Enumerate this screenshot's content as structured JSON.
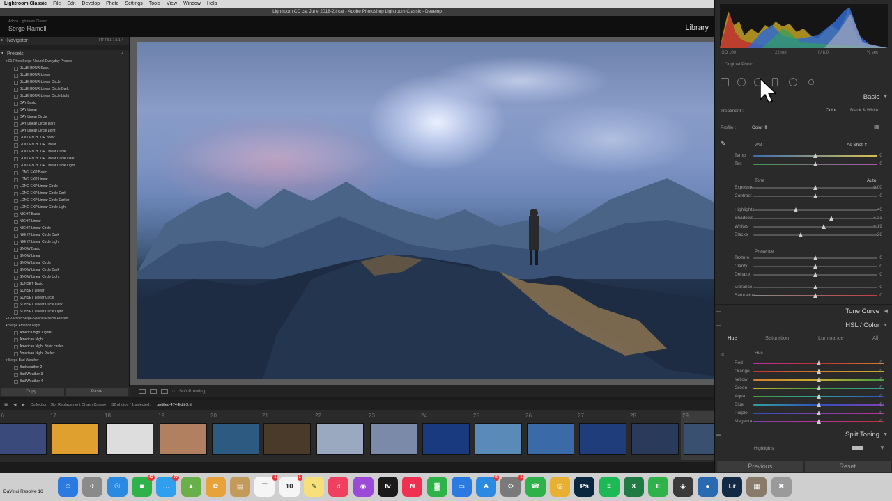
{
  "menubar": {
    "app": "Lightroom Classic",
    "items": [
      "File",
      "Edit",
      "Develop",
      "Photo",
      "Settings",
      "Tools",
      "View",
      "Window",
      "Help"
    ]
  },
  "window": {
    "title": "Lightroom CC cat June 2018-2.lrcat - Adobe Photoshop Lightroom Classic - Develop"
  },
  "identity": {
    "small": "Adobe Lightroom Classic",
    "name": "Serge Ramelli",
    "module": "Library"
  },
  "left_panel": {
    "navigator": "Navigator",
    "navigator_zoom": "FIT  FILL  1:1  1:4",
    "presets_label": "Presets",
    "groups": [
      {
        "name": "01-PhotoSerge-Natural Everyday Presets",
        "items": [
          "BLUE HOUR Basic",
          "BLUE HOUR Linear",
          "BLUE HOUR Linear Circle",
          "BLUE HOUR Linear Circle Dark",
          "BLUE HOUR Linear Circle Light",
          "DAY Basic",
          "DAY Linear",
          "DAY Linear Circle",
          "DAY Linear Circle Dark",
          "DAY Linear Circle Light",
          "GOLDEN HOUR Basic",
          "GOLDEN HOUR Linear",
          "GOLDEN HOUR Linear Circle",
          "GOLDEN HOUR Linear Circle Dark",
          "GOLDEN HOUR Linear Circle Light",
          "LONG EXP Basic",
          "LONG EXP Linear",
          "LONG EXP Linear Circle",
          "LONG EXP Linear Circle Dark",
          "LONG EXP Linear Circle Darker",
          "LONG EXP Linear Circle Light",
          "NIGHT Basic",
          "NIGHT Linear",
          "NIGHT Linear Circle",
          "NIGHT Linear Circle Dark",
          "NIGHT Linear Circle Light",
          "SNOW Basic",
          "SNOW Linear",
          "SNOW Linear Circle",
          "SNOW Linear Circle Dark",
          "SNOW Linear Circle Light",
          "SUNSET Basic",
          "SUNSET Linear",
          "SUNSET Linear Circle",
          "SUNSET Linear Circle Dark",
          "SUNSET Linear Circle Light"
        ]
      },
      {
        "name": "02-PhotoSerge-Special Effects Presets",
        "items": []
      },
      {
        "name": "Serge America Night",
        "items": [
          "America night Lighter",
          "American Night",
          "American Night Basic circles",
          "American Night Darker"
        ]
      },
      {
        "name": "Serge Bad Weather",
        "items": [
          "Bad weather 2",
          "Bad Weather 3",
          "Bad Weather 4"
        ]
      }
    ],
    "copy": "Copy...",
    "paste": "Paste"
  },
  "toolbar": {
    "soft_proofing": "Soft Proofing"
  },
  "filmstrip": {
    "collection": "Collection : Sky Replacement Chash Course",
    "count": "32 photos / 1 selected /",
    "file": "untitled-474-Edit-3.tif",
    "numbers": [
      "16",
      "17",
      "18",
      "19",
      "20",
      "21",
      "22",
      "23",
      "24",
      "25",
      "26",
      "27",
      "28",
      "29"
    ],
    "thumb_colors": [
      "#3a4a7a",
      "#e0a030",
      "#ddd",
      "#b08060",
      "#2c5a80",
      "#4a3a2a",
      "#9aa8c0",
      "#7a8aa8",
      "#1a3a80",
      "#5a8ab8",
      "#3a6aa8",
      "#1e3d7a",
      "#2a3a5a",
      "#3a5070"
    ]
  },
  "right_panel": {
    "histogram_info": {
      "iso": "ISO 100",
      "focal": "22 mm",
      "aperture": "f / 8.0",
      "shutter": "½ sec"
    },
    "original_photo": "Original Photo",
    "basic": {
      "title": "Basic",
      "treatment_label": "Treatment :",
      "treatment_color": "Color",
      "treatment_bw": "Black & White",
      "profile_label": "Profile :",
      "profile_value": "Color",
      "wb_label": "WB :",
      "wb_value": "As Shot",
      "tone_label": "Tone",
      "auto": "Auto",
      "presence_label": "Presence",
      "sliders": [
        {
          "label": "Temp",
          "value": "0"
        },
        {
          "label": "Tint",
          "value": "0"
        },
        {
          "label": "Exposure",
          "value": "0.00"
        },
        {
          "label": "Contrast",
          "value": "0"
        },
        {
          "label": "Highlights",
          "value": "− 40"
        },
        {
          "label": "Shadows",
          "value": "+ 33"
        },
        {
          "label": "Whites",
          "value": "+ 19"
        },
        {
          "label": "Blacks",
          "value": "− 28"
        },
        {
          "label": "Texture",
          "value": "0"
        },
        {
          "label": "Clarity",
          "value": "0"
        },
        {
          "label": "Dehaze",
          "value": "0"
        },
        {
          "label": "Vibrance",
          "value": "0"
        },
        {
          "label": "Saturation",
          "value": "0"
        }
      ]
    },
    "tone_curve": "Tone Curve",
    "hsl": {
      "title": "HSL / Color",
      "tabs": [
        "Hue",
        "Saturation",
        "Luminance",
        "All"
      ],
      "sub": "Hue",
      "sliders": [
        {
          "label": "Red",
          "value": "0"
        },
        {
          "label": "Orange",
          "value": "0"
        },
        {
          "label": "Yellow",
          "value": "0"
        },
        {
          "label": "Green",
          "value": "0"
        },
        {
          "label": "Aqua",
          "value": "0"
        },
        {
          "label": "Blue",
          "value": "0"
        },
        {
          "label": "Purple",
          "value": "0"
        },
        {
          "label": "Magenta",
          "value": "0"
        }
      ]
    },
    "split_toning": {
      "title": "Split Toning",
      "highlights": "Highlights"
    },
    "previous": "Previous",
    "reset": "Reset"
  },
  "dock": {
    "running_app": "DaVinci Resolve 16",
    "icons": [
      {
        "name": "finder",
        "glyph": "☺",
        "color": "#2a7ae2"
      },
      {
        "name": "launchpad",
        "glyph": "✈",
        "color": "#8a8a8a"
      },
      {
        "name": "safari",
        "glyph": "☉",
        "color": "#2a8ae2"
      },
      {
        "name": "facetime",
        "glyph": "■",
        "color": "#2fb24a",
        "badge": "42"
      },
      {
        "name": "messages",
        "glyph": "…",
        "color": "#2fa0f0",
        "badge": "77"
      },
      {
        "name": "maps",
        "glyph": "▲",
        "color": "#6ab04a"
      },
      {
        "name": "photos",
        "glyph": "✿",
        "color": "#e7a23a"
      },
      {
        "name": "notes-folder",
        "glyph": "▤",
        "color": "#c49a5a"
      },
      {
        "name": "reminders",
        "glyph": "☰",
        "color": "#f5f5f5",
        "badge": "1"
      },
      {
        "name": "calendar",
        "glyph": "10",
        "color": "#f5f5f5",
        "badge": "1"
      },
      {
        "name": "notes",
        "glyph": "✎",
        "color": "#f7e07a"
      },
      {
        "name": "music",
        "glyph": "♫",
        "color": "#f04060"
      },
      {
        "name": "podcasts",
        "glyph": "◉",
        "color": "#9b4ad8"
      },
      {
        "name": "tv",
        "glyph": "tv",
        "color": "#1a1a1a"
      },
      {
        "name": "news",
        "glyph": "N",
        "color": "#f03050"
      },
      {
        "name": "numbers",
        "glyph": "▓",
        "color": "#2fb24a"
      },
      {
        "name": "keynote",
        "glyph": "▭",
        "color": "#2a7ae2"
      },
      {
        "name": "app-store",
        "glyph": "A",
        "color": "#2a8ae2",
        "badge": "6"
      },
      {
        "name": "system-preferences",
        "glyph": "⚙",
        "color": "#7a7a7a",
        "badge": "1"
      },
      {
        "name": "whatsapp",
        "glyph": "☎",
        "color": "#2fb24a"
      },
      {
        "name": "chrome",
        "glyph": "◎",
        "color": "#e8b030"
      },
      {
        "name": "photoshop",
        "glyph": "Ps",
        "color": "#0b2740"
      },
      {
        "name": "spotify",
        "glyph": "≡",
        "color": "#1db954"
      },
      {
        "name": "excel",
        "glyph": "X",
        "color": "#1f7a44"
      },
      {
        "name": "evernote",
        "glyph": "E",
        "color": "#2fb24a"
      },
      {
        "name": "davinci-resolve",
        "glyph": "◈",
        "color": "#3a3a3a"
      },
      {
        "name": "camera-app",
        "glyph": "●",
        "color": "#2a6ab0"
      },
      {
        "name": "lightroom-classic",
        "glyph": "Lr",
        "color": "#132a44"
      },
      {
        "name": "preview-gallery",
        "glyph": "▦",
        "color": "#8a7a6a"
      },
      {
        "name": "trash",
        "glyph": "✖",
        "color": "#9a9a9a"
      }
    ]
  },
  "colors": {
    "accent": "#cfcfcf",
    "panel": "#2a2a2a",
    "viewer": "#5a5a5a"
  }
}
